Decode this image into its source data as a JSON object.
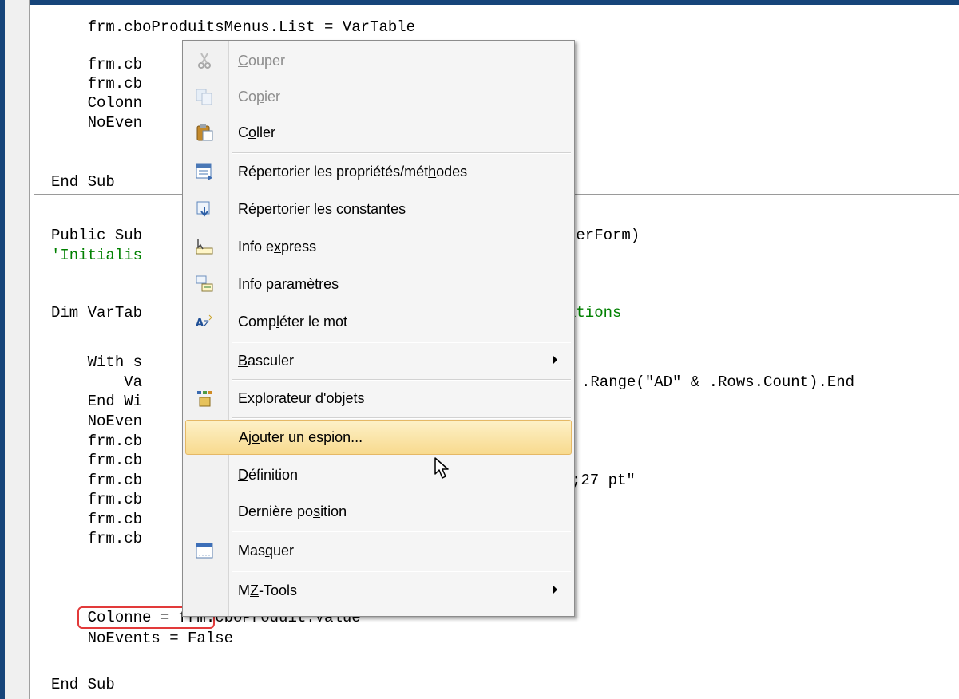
{
  "code_lines": [
    {
      "text": "    frm.cboProduitsMenus.List = VarTable"
    },
    {
      "text": "    frm.cb"
    },
    {
      "text": "    frm.cb"
    },
    {
      "text": "    Colonn"
    },
    {
      "text": "    NoEven"
    },
    {
      "text": ""
    },
    {
      "text": "End Sub"
    },
    {
      "text": "Public Sub"
    },
    {
      "text": "'Initialis"
    },
    {
      "text": "Dim VarTab"
    },
    {
      "text": "    With s"
    },
    {
      "text": "        Va"
    },
    {
      "text": "    End Wi"
    },
    {
      "text": "    NoEven"
    },
    {
      "text": "    frm.cb"
    },
    {
      "text": "    frm.cb"
    },
    {
      "text": "    frm.cb"
    },
    {
      "text": "    frm.cb"
    },
    {
      "text": "    frm.cb"
    },
    {
      "text": "    frm.cb"
    },
    {
      "text": "    Colonne = frm.cboProduit.Value"
    },
    {
      "text": "    NoEvents = False"
    },
    {
      "text": "End Sub"
    }
  ],
  "code_fragments_right": {
    "public_sub_tail": "serForm)",
    "dim_tail": "ations",
    "range_tail": ".Range(\"AD\" & .Rows.Count).End",
    "pt_tail": ";27 pt\""
  },
  "context_menu": {
    "items": [
      {
        "pre": "",
        "u": "C",
        "post": "ouper",
        "icon": "cut-icon",
        "disabled": true
      },
      {
        "pre": "Co",
        "u": "p",
        "post": "ier",
        "icon": "copy-icon",
        "disabled": true
      },
      {
        "pre": "C",
        "u": "o",
        "post": "ller",
        "icon": "paste-icon",
        "disabled": false
      },
      {
        "pre": "Répertorier les propriétés/mét",
        "u": "h",
        "post": "odes",
        "icon": "list-properties-icon",
        "disabled": false
      },
      {
        "pre": "Répertorier les co",
        "u": "n",
        "post": "stantes",
        "icon": "list-constants-icon",
        "disabled": false
      },
      {
        "pre": "Info e",
        "u": "x",
        "post": "press",
        "icon": "quick-info-icon",
        "disabled": false
      },
      {
        "pre": "Info para",
        "u": "m",
        "post": "ètres",
        "icon": "parameter-info-icon",
        "disabled": false
      },
      {
        "pre": "Comp",
        "u": "l",
        "post": "éter le mot",
        "icon": "complete-word-icon",
        "disabled": false
      },
      {
        "pre": "",
        "u": "B",
        "post": "asculer",
        "icon": "",
        "disabled": false,
        "submenu": true
      },
      {
        "pre": "Explorateur d'objets",
        "u": "",
        "post": "",
        "icon": "object-browser-icon",
        "disabled": false
      },
      {
        "pre": "Aj",
        "u": "o",
        "post": "uter un espion...",
        "icon": "",
        "disabled": false,
        "hover": true
      },
      {
        "pre": "",
        "u": "D",
        "post": "éfinition",
        "icon": "",
        "disabled": false
      },
      {
        "pre": "Dernière po",
        "u": "s",
        "post": "ition",
        "icon": "",
        "disabled": false
      },
      {
        "pre": "Mas",
        "u": "q",
        "post": "uer",
        "icon": "hide-window-icon",
        "disabled": false
      },
      {
        "pre": "M",
        "u": "Z",
        "post": "-Tools",
        "icon": "",
        "disabled": false,
        "submenu": true
      }
    ]
  }
}
